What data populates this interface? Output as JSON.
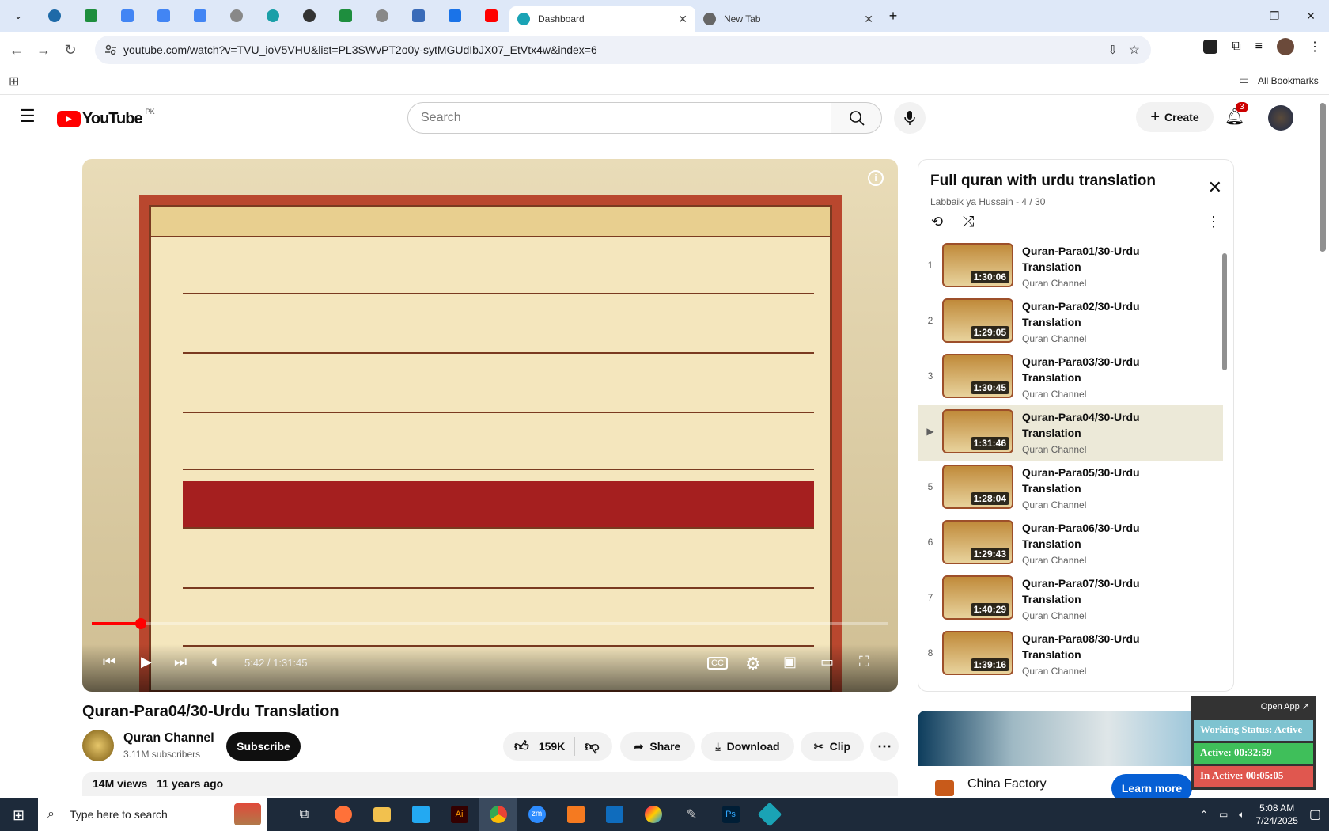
{
  "browser": {
    "tabs": [
      {
        "label": "Dashboard"
      },
      {
        "label": "New Tab"
      }
    ],
    "url": "youtube.com/watch?v=TVU_ioV5VHU&list=PL3SWvPT2o0y-sytMGUdIbJX07_EtVtx4w&index=6",
    "bookmarks_label": "All Bookmarks"
  },
  "header": {
    "logo": "YouTube",
    "region": "PK",
    "search_placeholder": "Search",
    "create_label": "Create",
    "notifications": "3"
  },
  "player": {
    "time": "5:42 / 1:31:45",
    "progress": 0.062
  },
  "video": {
    "title": "Quran-Para04/30-Urdu Translation",
    "channel": "Quran Channel",
    "subscribers": "3.11M subscribers",
    "subscribe_label": "Subscribe",
    "likes": "159K",
    "share_label": "Share",
    "download_label": "Download",
    "clip_label": "Clip",
    "views": "14M views",
    "age": "11 years ago"
  },
  "playlist": {
    "title": "Full quran with urdu translation",
    "subtitle": "Labbaik ya Hussain - 4 / 30",
    "items": [
      {
        "index": "1",
        "title": "Quran-Para01/30-Urdu Translation",
        "duration": "1:30:06",
        "channel": "Quran Channel"
      },
      {
        "index": "2",
        "title": "Quran-Para02/30-Urdu Translation",
        "duration": "1:29:05",
        "channel": "Quran Channel"
      },
      {
        "index": "3",
        "title": "Quran-Para03/30-Urdu Translation",
        "duration": "1:30:45",
        "channel": "Quran Channel"
      },
      {
        "index": "▶",
        "title": "Quran-Para04/30-Urdu Translation",
        "duration": "1:31:46",
        "channel": "Quran Channel"
      },
      {
        "index": "5",
        "title": "Quran-Para05/30-Urdu Translation",
        "duration": "1:28:04",
        "channel": "Quran Channel"
      },
      {
        "index": "6",
        "title": "Quran-Para06/30-Urdu Translation",
        "duration": "1:29:43",
        "channel": "Quran Channel"
      },
      {
        "index": "7",
        "title": "Quran-Para07/30-Urdu Translation",
        "duration": "1:40:29",
        "channel": "Quran Channel"
      },
      {
        "index": "8",
        "title": "Quran-Para08/30-Urdu Translation",
        "duration": "1:39:16",
        "channel": "Quran Channel"
      }
    ]
  },
  "ad": {
    "name": "China Factory",
    "cta": "Learn more"
  },
  "widget": {
    "open_app": "Open App ↗",
    "status": "Working Status: Active",
    "active": "Active: 00:32:59",
    "inactive": "In Active: 00:05:05"
  },
  "taskbar": {
    "search_placeholder": "Type here to search",
    "time": "5:08 AM",
    "date": "7/24/2025"
  },
  "colors": {
    "accent": "#ff0000",
    "subscribe_bg": "#0f0f0f",
    "learn_more": "#065fd4"
  }
}
